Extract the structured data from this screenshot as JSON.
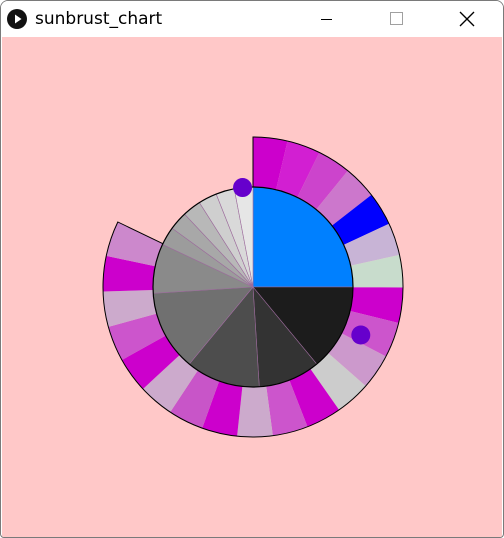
{
  "window": {
    "title": "sunbrust_chart",
    "controls": [
      "minimize",
      "maximize",
      "close"
    ]
  },
  "canvas": {
    "background": "#ffc8c8"
  },
  "chart_data": {
    "type": "sunburst",
    "inner_ring": [
      {
        "value": 25,
        "color": "#0080ff"
      },
      {
        "value": 14,
        "color": "#1c1c1c"
      },
      {
        "value": 10,
        "color": "#333333"
      },
      {
        "value": 12,
        "color": "#4d4d4d"
      },
      {
        "value": 13,
        "color": "#707070"
      },
      {
        "value": 8,
        "color": "#8a8a8a"
      },
      {
        "value": 3,
        "color": "#9c9c9c"
      },
      {
        "value": 3,
        "color": "#a8a8a8"
      },
      {
        "value": 3,
        "color": "#b8b8b8"
      },
      {
        "value": 3,
        "color": "#cfcfcf"
      },
      {
        "value": 3,
        "color": "#d9d9d9"
      },
      {
        "value": 3,
        "color": "#e6e6e6"
      }
    ],
    "outer_ring": [
      {
        "value": 3.5,
        "color": "#cc00cc"
      },
      {
        "value": 3.4,
        "color": "#d21fd2"
      },
      {
        "value": 3.4,
        "color": "#cc44cc"
      },
      {
        "value": 3.4,
        "color": "#cc77cc"
      },
      {
        "value": 3.4,
        "color": "#0000ff"
      },
      {
        "value": 3.3,
        "color": "#c8b4d6"
      },
      {
        "value": 3.3,
        "color": "#c8dccc"
      },
      {
        "value": 3.6,
        "color": "#cc00cc"
      },
      {
        "value": 3.6,
        "color": "#cc55cc"
      },
      {
        "value": 3.6,
        "color": "#cc99cc"
      },
      {
        "value": 3.6,
        "color": "#cccccc"
      },
      {
        "value": 3.6,
        "color": "#cc00cc"
      },
      {
        "value": 3.6,
        "color": "#cc55cc"
      },
      {
        "value": 3.6,
        "color": "#ccaacc"
      },
      {
        "value": 3.6,
        "color": "#cc00cc"
      },
      {
        "value": 3.6,
        "color": "#c855c8"
      },
      {
        "value": 3.6,
        "color": "#ccaacc"
      },
      {
        "value": 3.6,
        "color": "#cc00cc"
      },
      {
        "value": 3.6,
        "color": "#cc55cc"
      },
      {
        "value": 3.6,
        "color": "#ccaacc"
      },
      {
        "value": 3.6,
        "color": "#cc00cc"
      },
      {
        "value": 3.6,
        "color": "#cc88cc"
      },
      {
        "value": 16.9,
        "color": null
      }
    ],
    "markers": [
      {
        "angle_deg": -6,
        "ring": "mid",
        "color": "#6600cc"
      },
      {
        "angle_deg": 114,
        "ring": "mid",
        "color": "#6600cc"
      }
    ],
    "stroke": "#000000",
    "inner_divider": "#9c6b9c"
  }
}
